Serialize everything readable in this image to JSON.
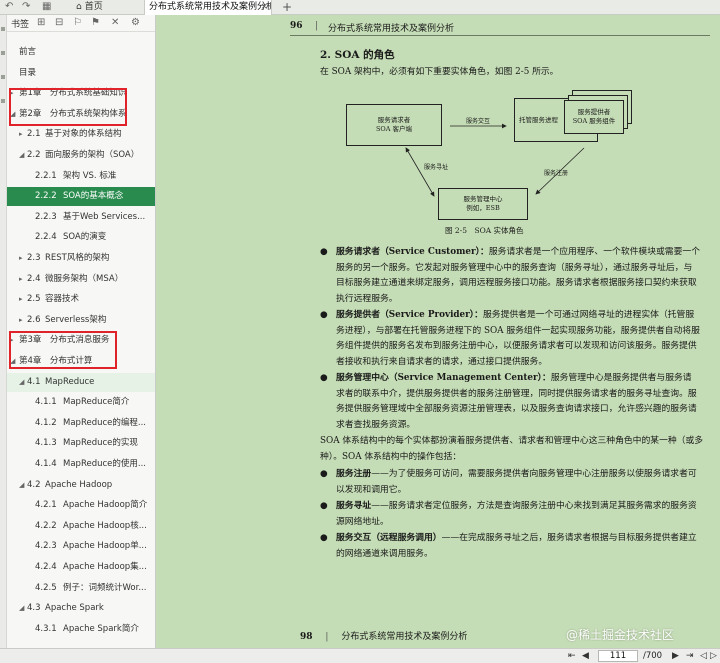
{
  "tabbar": {
    "home_label": "首页",
    "doc_tab_title": "分布式系统常用技术及案例分析",
    "close_glyph": "×",
    "add_glyph": "+",
    "icons": [
      "back-icon",
      "forward-icon",
      "grid-icon",
      "home-icon"
    ]
  },
  "sidebar": {
    "title": "书签",
    "icons": [
      "expand-icon",
      "collapse-icon",
      "bookmark-icon",
      "bookmark-add-icon",
      "delete-icon",
      "settings-icon"
    ],
    "items": [
      {
        "level": 0,
        "arrow": "",
        "num": "",
        "label": "前言"
      },
      {
        "level": 0,
        "arrow": "",
        "num": "",
        "label": "目录"
      },
      {
        "level": 0,
        "arrow": "▸",
        "num": "",
        "label": "第1章　分布式系统基础知识"
      },
      {
        "level": 0,
        "arrow": "◢",
        "num": "",
        "label": "第2章　分布式系统架构体系"
      },
      {
        "level": 1,
        "arrow": "▸",
        "num": "2.1",
        "label": "基于对象的体系结构"
      },
      {
        "level": 1,
        "arrow": "◢",
        "num": "2.2",
        "label": "面向服务的架构（SOA）"
      },
      {
        "level": 2,
        "arrow": "",
        "num": "2.2.1",
        "label": "架构 VS. 标准"
      },
      {
        "level": 2,
        "arrow": "",
        "num": "2.2.2",
        "label": "SOA的基本概念",
        "active": true
      },
      {
        "level": 2,
        "arrow": "",
        "num": "2.2.3",
        "label": "基于Web Services..."
      },
      {
        "level": 2,
        "arrow": "",
        "num": "2.2.4",
        "label": "SOA的演变"
      },
      {
        "level": 1,
        "arrow": "▸",
        "num": "2.3",
        "label": "REST风格的架构"
      },
      {
        "level": 1,
        "arrow": "▸",
        "num": "2.4",
        "label": "微服务架构（MSA）"
      },
      {
        "level": 1,
        "arrow": "▸",
        "num": "2.5",
        "label": "容器技术"
      },
      {
        "level": 1,
        "arrow": "▸",
        "num": "2.6",
        "label": "Serverless架构"
      },
      {
        "level": 0,
        "arrow": "▸",
        "num": "",
        "label": "第3章　分布式消息服务"
      },
      {
        "level": 0,
        "arrow": "◢",
        "num": "",
        "label": "第4章　分布式计算"
      },
      {
        "level": 1,
        "arrow": "◢",
        "num": "4.1",
        "label": "MapReduce",
        "light": true
      },
      {
        "level": 2,
        "arrow": "",
        "num": "4.1.1",
        "label": "MapReduce简介"
      },
      {
        "level": 2,
        "arrow": "",
        "num": "4.1.2",
        "label": "MapReduce的编程..."
      },
      {
        "level": 2,
        "arrow": "",
        "num": "4.1.3",
        "label": "MapReduce的实现"
      },
      {
        "level": 2,
        "arrow": "",
        "num": "4.1.4",
        "label": "MapReduce的使用..."
      },
      {
        "level": 1,
        "arrow": "◢",
        "num": "4.2",
        "label": "Apache Hadoop"
      },
      {
        "level": 2,
        "arrow": "",
        "num": "4.2.1",
        "label": "Apache Hadoop简介"
      },
      {
        "level": 2,
        "arrow": "",
        "num": "4.2.2",
        "label": "Apache Hadoop核..."
      },
      {
        "level": 2,
        "arrow": "",
        "num": "4.2.3",
        "label": "Apache Hadoop单..."
      },
      {
        "level": 2,
        "arrow": "",
        "num": "4.2.4",
        "label": "Apache Hadoop集..."
      },
      {
        "level": 2,
        "arrow": "",
        "num": "4.2.5",
        "label": "例子：词频统计Wor..."
      },
      {
        "level": 1,
        "arrow": "◢",
        "num": "4.3",
        "label": "Apache Spark"
      },
      {
        "level": 2,
        "arrow": "",
        "num": "4.3.1",
        "label": "Apache Spark简介"
      }
    ]
  },
  "page": {
    "number": "96",
    "book_title": "分布式系统常用技术及案例分析",
    "divider": "|",
    "section_title": "2. SOA 的角色",
    "intro": "在 SOA 架构中，必须有如下重要实体角色，如图 2-5 所示。",
    "diagram": {
      "requester_line1": "服务请求者",
      "requester_line2": "SOA 客户端",
      "provider_line1": "托管服务进程",
      "component_line1": "服务提供者",
      "component_line2": "SOA 服务组件",
      "center_line1": "服务管理中心",
      "center_line2": "例如，ESB",
      "edge_interact": "服务交互",
      "edge_find": "服务寻址",
      "edge_register": "服务注册",
      "caption": "图 2-5　SOA 实体角色"
    },
    "bullets": [
      {
        "term": "服务请求者（Service Customer）：",
        "text": "服务请求者是一个应用程序、一个软件模块或需要一个服务的另一个服务。它发起对服务管理中心中的服务查询（服务寻址），通过服务寻址后，与目标服务建立通道来绑定服务，调用远程服务接口功能。服务请求者根据服务接口契约来获取执行远程服务。"
      },
      {
        "term": "服务提供者（Service Provider）：",
        "text": "服务提供者是一个可通过网络寻址的进程实体（托管服务进程），与部署在托管服务进程下的 SOA 服务组件一起实现服务功能，服务提供者自动将服务组件提供的服务名发布到服务注册中心，以便服务请求者可以发现和访问该服务。服务提供者接收和执行来自请求者的请求，通过接口提供服务。"
      },
      {
        "term": "服务管理中心（Service Management Center）：",
        "text": "服务管理中心是服务提供者与服务请求者的联系中介，提供服务提供者的服务注册管理，同时提供服务请求者的服务寻址查询。服务提供服务管理域中全部服务资源注册管理表，以及服务查询请求接口，允许感兴趣的服务请求者查找服务资源。"
      }
    ],
    "mid_para": "SOA 体系结构中的每个实体都扮演着服务提供者、请求者和管理中心这三种角色中的某一种（或多种）。SOA 体系结构中的操作包括：",
    "ops": [
      {
        "term": "服务注册",
        "text": "——为了使服务可访问，需要服务提供者向服务管理中心注册服务以使服务请求者可以发现和调用它。"
      },
      {
        "term": "服务寻址",
        "text": "——服务请求者定位服务，方法是查询服务注册中心来找到满足其服务需求的服务资源网络地址。"
      },
      {
        "term": "服务交互（远程服务调用）",
        "text": "——在完成服务寻址之后，服务请求者根据与目标服务提供者建立的网络通道来调用服务。"
      }
    ],
    "bullet_glyph": "●",
    "next_page_number": "98",
    "next_book_title": "分布式系统常用技术及案例分析"
  },
  "watermark": "@稀土掘金技术社区",
  "bottombar": {
    "current_page": "111",
    "total_pages": "/700",
    "icons": [
      "first-page-icon",
      "prev-page-icon",
      "next-page-icon",
      "last-page-icon",
      "prev-view-icon",
      "next-view-icon"
    ]
  },
  "colors": {
    "page_bg": "#c5ddb6",
    "active_item": "#2a8b4e",
    "highlight_box": "#e0232a"
  }
}
